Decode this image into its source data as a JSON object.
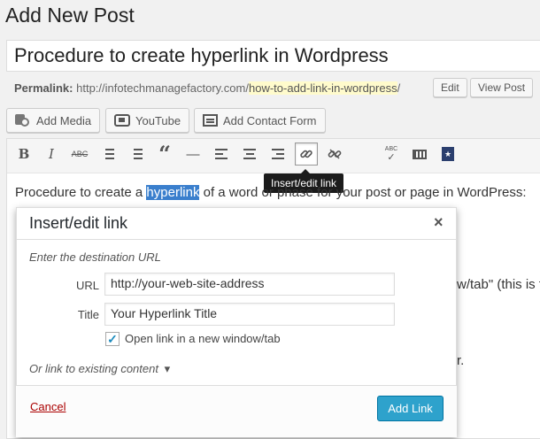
{
  "page": {
    "heading": "Add New Post"
  },
  "post": {
    "title_value": "Procedure to create hyperlink in Wordpress",
    "permalink_label": "Permalink:",
    "permalink_base": "http://infotechmanagefactory.com/",
    "permalink_slug": "how-to-add-link-in-wordpress",
    "permalink_end": "/",
    "edit_label": "Edit",
    "view_label": "View Post"
  },
  "media_buttons": {
    "add_media": "Add Media",
    "youtube": "YouTube",
    "contact_form": "Add Contact Form"
  },
  "toolbar": {
    "bold": "B",
    "italic": "I",
    "strike": "ABC",
    "blockquote": "“",
    "hr": "—",
    "spellcheck": "ABC",
    "tooltip": "Insert/edit link"
  },
  "content": {
    "before": "Procedure to create a ",
    "selected": "hyperlink",
    "after": " of a word or phase for your post or page in WordPress:",
    "frag_tab": "w/tab\" (this is th",
    "frag_r": "r."
  },
  "dialog": {
    "title": "Insert/edit link",
    "close": "×",
    "hint": "Enter the destination URL",
    "url_label": "URL",
    "url_value": "http://your-web-site-address",
    "title_label": "Title",
    "title_value": "Your Hyperlink Title",
    "checkbox_checked": true,
    "checkbox_mark": "✓",
    "checkbox_label": "Open link in a new window/tab",
    "existing_link": "Or link to existing content",
    "existing_arrow": "▾",
    "cancel": "Cancel",
    "submit": "Add Link"
  }
}
